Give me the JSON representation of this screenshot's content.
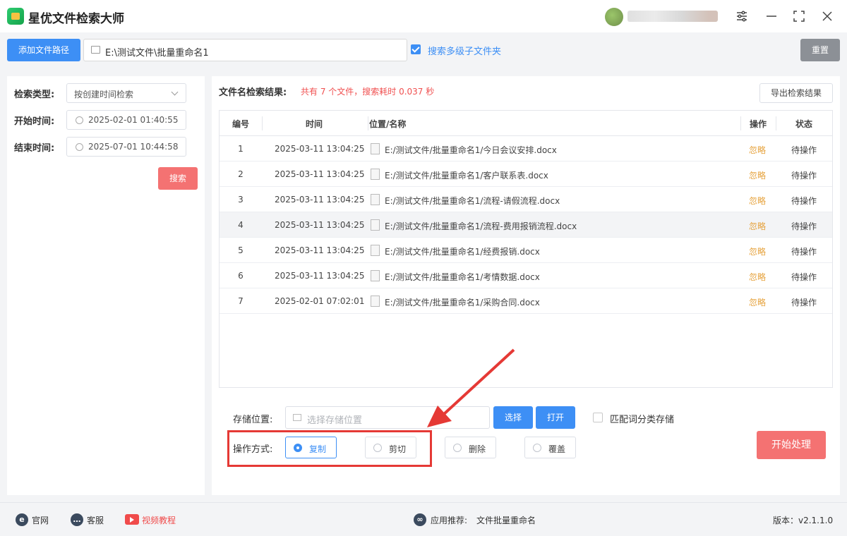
{
  "app": {
    "title": "星优文件检索大师",
    "window_buttons": [
      "settings-icon",
      "minimize-icon",
      "maximize-icon",
      "close-icon"
    ]
  },
  "toolbar": {
    "add_path_label": "添加文件路径",
    "path_value": "E:\\测试文件\\批量重命名1",
    "subfolder_checked": true,
    "subfolder_label": "搜索多级子文件夹",
    "reset_label": "重置"
  },
  "filters": {
    "search_type_label": "检索类型:",
    "search_type_value": "按创建时间检索",
    "start_label": "开始时间:",
    "start_value": "2025-02-01 01:40:55",
    "end_label": "结束时间:",
    "end_value": "2025-07-01 10:44:58",
    "search_button": "搜索"
  },
  "results": {
    "title": "文件名检索结果:",
    "summary": "共有 7 个文件，搜索耗时 0.037 秒",
    "export_label": "导出检索结果",
    "columns": [
      "编号",
      "时间",
      "位置/名称",
      "操作",
      "状态"
    ],
    "rows": [
      {
        "no": "1",
        "time": "2025-03-11 13:04:25",
        "path": "E:/测试文件/批量重命名1/今日会议安排.docx",
        "op": "忽略",
        "status": "待操作"
      },
      {
        "no": "2",
        "time": "2025-03-11 13:04:25",
        "path": "E:/测试文件/批量重命名1/客户联系表.docx",
        "op": "忽略",
        "status": "待操作"
      },
      {
        "no": "3",
        "time": "2025-03-11 13:04:25",
        "path": "E:/测试文件/批量重命名1/流程-请假流程.docx",
        "op": "忽略",
        "status": "待操作"
      },
      {
        "no": "4",
        "time": "2025-03-11 13:04:25",
        "path": "E:/测试文件/批量重命名1/流程-费用报销流程.docx",
        "op": "忽略",
        "status": "待操作"
      },
      {
        "no": "5",
        "time": "2025-03-11 13:04:25",
        "path": "E:/测试文件/批量重命名1/经费报销.docx",
        "op": "忽略",
        "status": "待操作"
      },
      {
        "no": "6",
        "time": "2025-03-11 13:04:25",
        "path": "E:/测试文件/批量重命名1/考情数据.docx",
        "op": "忽略",
        "status": "待操作"
      },
      {
        "no": "7",
        "time": "2025-02-01 07:02:01",
        "path": "E:/测试文件/批量重命名1/采购合同.docx",
        "op": "忽略",
        "status": "待操作"
      }
    ]
  },
  "storage": {
    "label": "存储位置:",
    "placeholder": "选择存储位置",
    "choose_label": "选择",
    "open_label": "打开",
    "classify_checked": false,
    "classify_label": "匹配词分类存储"
  },
  "operation": {
    "label": "操作方式:",
    "options": [
      "复制",
      "剪切",
      "删除",
      "覆盖"
    ],
    "selected": "复制",
    "start_label": "开始处理"
  },
  "footer": {
    "website": "官网",
    "support": "客服",
    "video": "视频教程",
    "recommend_label": "应用推荐:",
    "recommend_value": "文件批量重命名",
    "version": "版本：v2.1.1.0"
  },
  "colors": {
    "accent": "#3d8ff5",
    "danger": "#f47272",
    "warning": "#e6a23c",
    "highlight_box": "#e53935"
  }
}
